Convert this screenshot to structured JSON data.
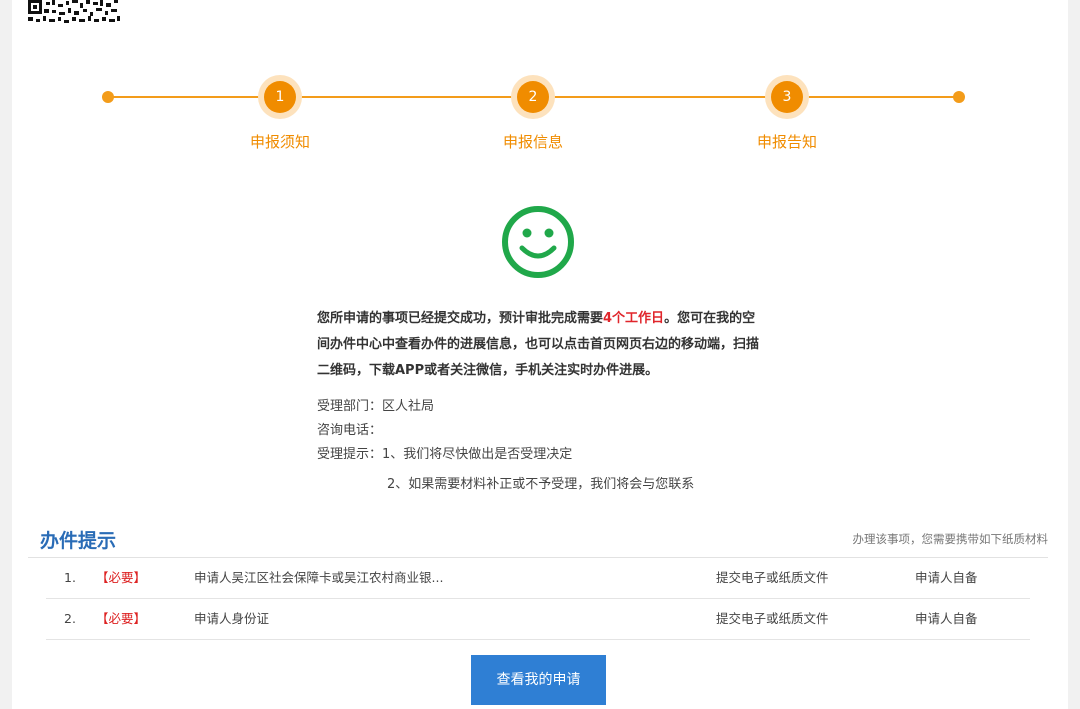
{
  "steps": [
    {
      "number": "1",
      "label": "申报须知"
    },
    {
      "number": "2",
      "label": "申报信息"
    },
    {
      "number": "3",
      "label": "申报告知"
    }
  ],
  "result": {
    "message_prefix": "您所申请的事项已经提交成功，预计审批完成需要",
    "message_highlight": "4个工作日",
    "message_suffix": "。您可在我的空间办件中心中查看办件的进展信息，也可以点击首页网页右边的移动端，扫描二维码，下载APP或者关注微信，手机关注实时办件进展。"
  },
  "info": {
    "dept_label": "受理部门：",
    "dept_value": "区人社局",
    "phone_label": "咨询电话：",
    "phone_value": "",
    "tips_label": "受理提示：",
    "tip1": "1、我们将尽快做出是否受理决定",
    "tip2": "2、如果需要材料补正或不予受理，我们将会与您联系"
  },
  "section": {
    "title": "办件提示",
    "note": "办理该事项，您需要携带如下纸质材料"
  },
  "documents": [
    {
      "no": "1.",
      "tag": "【必要】",
      "name": "申请人吴江区社会保障卡或吴江农村商业银...",
      "type": "提交电子或纸质文件",
      "source": "申请人自备"
    },
    {
      "no": "2.",
      "tag": "【必要】",
      "name": "申请人身份证",
      "type": "提交电子或纸质文件",
      "source": "申请人自备"
    }
  ],
  "actions": {
    "view_label": "查看我的申请"
  },
  "colors": {
    "accent_orange": "#f08c00",
    "success_green": "#20a84a",
    "highlight_red": "#e0252b",
    "primary_blue": "#2f7fd4"
  }
}
